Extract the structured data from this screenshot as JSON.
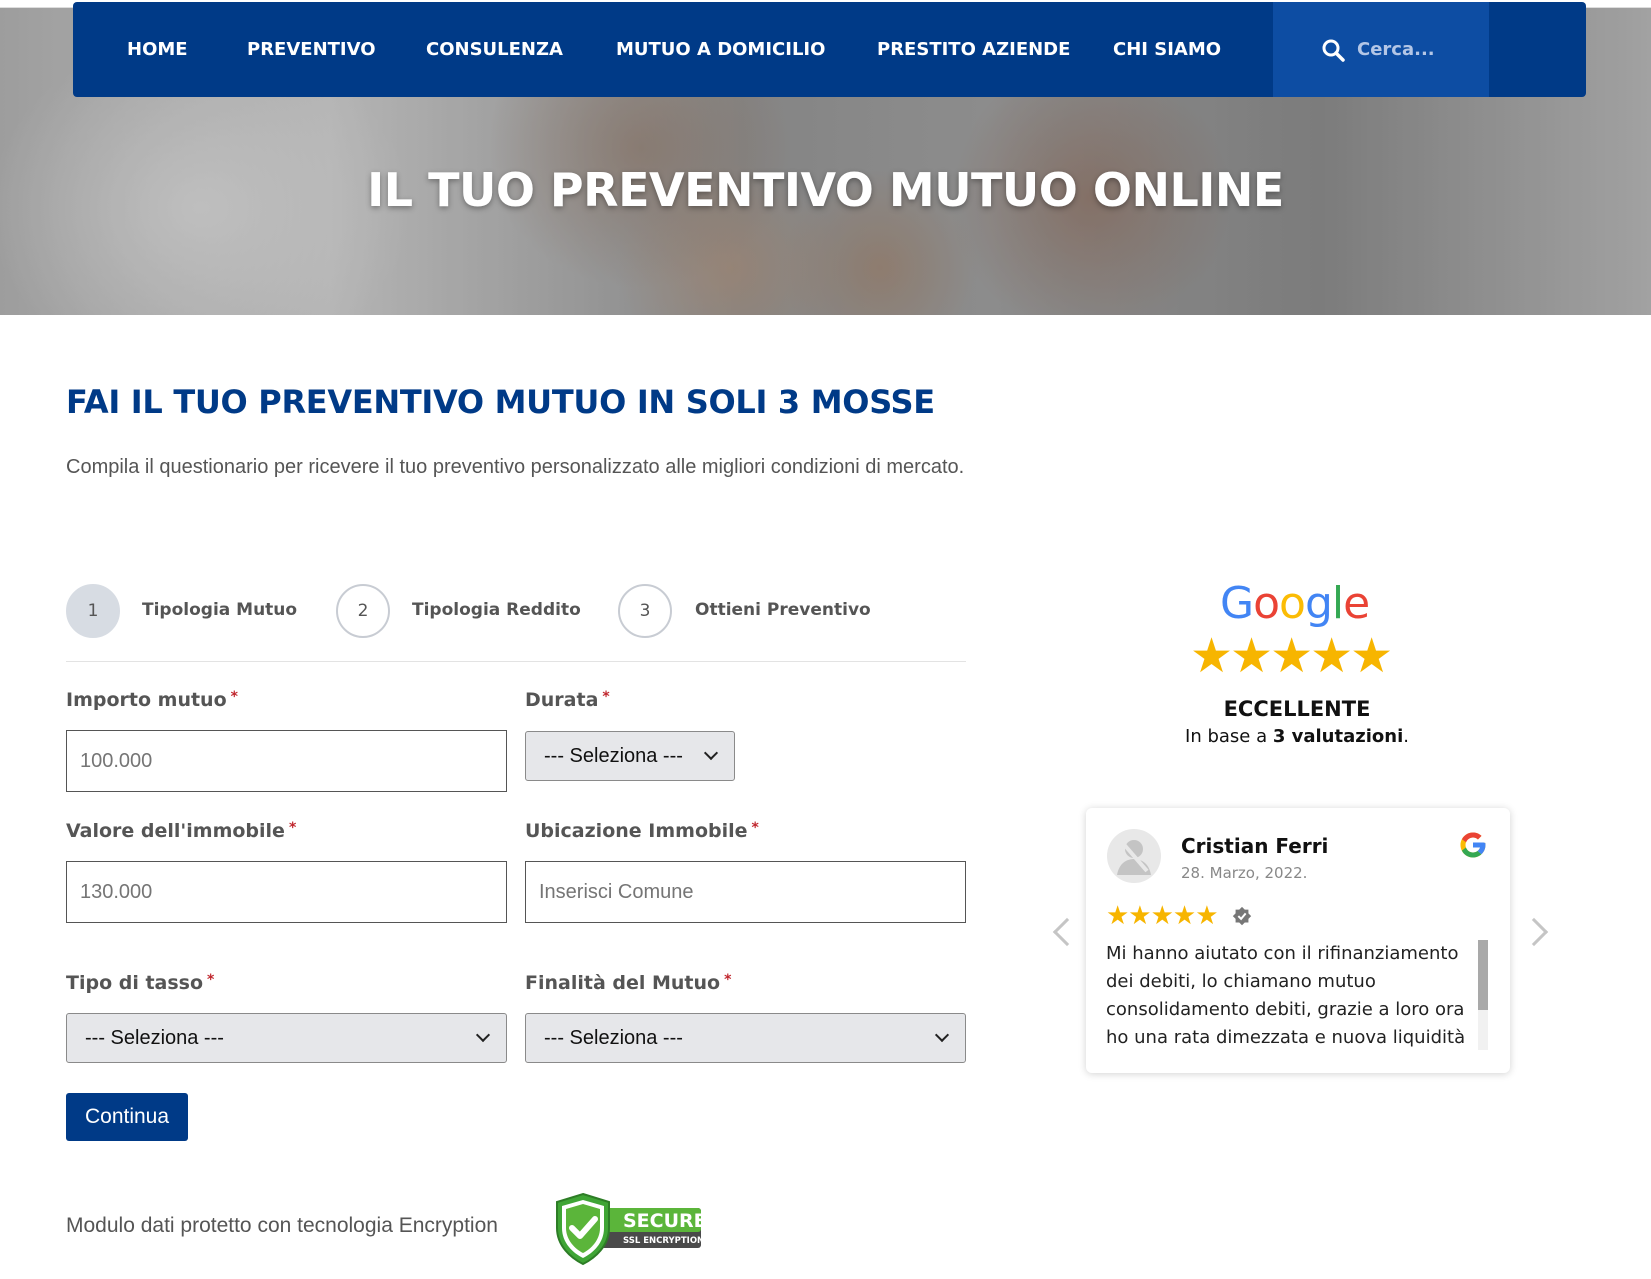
{
  "nav": {
    "items": [
      "HOME",
      "PREVENTIVO",
      "CONSULENZA",
      "MUTUO A DOMICILIO",
      "PRESTITO AZIENDE",
      "CHI SIAMO"
    ],
    "search_label": "Cerca..."
  },
  "hero": {
    "title": "IL TUO PREVENTIVO MUTUO ONLINE"
  },
  "section": {
    "title": "FAI IL TUO PREVENTIVO MUTUO IN SOLI 3 MOSSE",
    "subtitle": "Compila il questionario per ricevere il tuo preventivo personalizzato alle migliori condizioni di mercato."
  },
  "steps": [
    {
      "number": "1",
      "label": "Tipologia Mutuo",
      "active": true
    },
    {
      "number": "2",
      "label": "Tipologia Reddito",
      "active": false
    },
    {
      "number": "3",
      "label": "Ottieni Preventivo",
      "active": false
    }
  ],
  "form": {
    "importo_label": "Importo mutuo",
    "importo_placeholder": "100.000",
    "durata_label": "Durata",
    "durata_value": "--- Seleziona ---",
    "valore_label": "Valore dell'immobile",
    "valore_placeholder": "130.000",
    "ubicazione_label": "Ubicazione Immobile",
    "ubicazione_placeholder": "Inserisci Comune",
    "tasso_label": "Tipo di tasso",
    "tasso_value": "--- Seleziona ---",
    "finalita_label": "Finalità del Mutuo",
    "finalita_value": "--- Seleziona ---",
    "required_mark": "*",
    "continue_label": "Continua"
  },
  "security": {
    "note": "Modulo dati protetto con tecnologia Encryption",
    "badge_title": "SECURE",
    "badge_sub": "SSL ENCRYPTION"
  },
  "reviews": {
    "brand": "Google",
    "stars": "★★★★★",
    "rating_word": "ECCELLENTE",
    "based_prefix": "In base a ",
    "based_count": "3 valutazioni",
    "based_suffix": ".",
    "card": {
      "name": "Cristian Ferri",
      "date": "28. Marzo, 2022.",
      "stars": "★★★★★",
      "text": "Mi hanno aiutato con il rifinanziamento dei debiti, lo chiamano mutuo consolidamento debiti, grazie a loro ora ho una rata dimezzata e nuova liquidità"
    }
  },
  "colors": {
    "brand_blue": "#003a87",
    "search_bg": "#0d4da3",
    "star": "#f7b500",
    "required": "#c0262d"
  }
}
